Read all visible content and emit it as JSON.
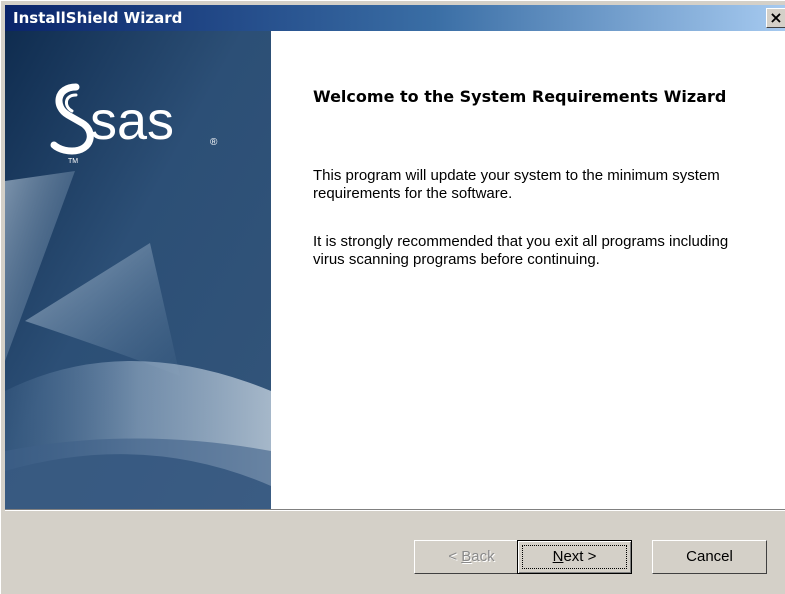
{
  "window": {
    "title": "InstallShield Wizard",
    "close_label": "×"
  },
  "side_panel": {
    "logo_text": "sas",
    "logo_tm": "TM",
    "logo_reg": "®"
  },
  "main": {
    "heading": "Welcome to the System Requirements Wizard",
    "paragraph1": "This program will update your system to the minimum system requirements for the software.",
    "paragraph2": "It is strongly recommended that you exit all programs including virus scanning programs before continuing."
  },
  "buttons": {
    "back_prefix": "< ",
    "back_accel": "B",
    "back_rest": "ack",
    "next_accel": "N",
    "next_rest": "ext >",
    "cancel": "Cancel"
  },
  "colors": {
    "title_gradient_start": "#0a246a",
    "title_gradient_end": "#a6caf0",
    "side_panel_dark": "#1d3b5e",
    "side_panel_light": "#6c8eb0",
    "dialog_face": "#d4d0c8"
  },
  "icons": {
    "close": "close-icon",
    "logo": "sas-logo-icon"
  },
  "states": {
    "back_enabled": false,
    "next_default": true
  }
}
